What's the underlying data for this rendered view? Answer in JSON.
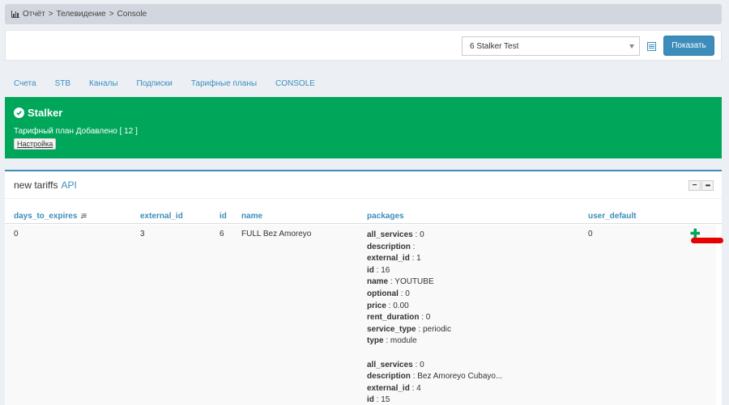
{
  "breadcrumb": {
    "items": [
      "Отчёт",
      "Телевидение",
      "Console"
    ],
    "separator": ">"
  },
  "toolbar": {
    "select_value": "6 Stalker Test",
    "show_label": "Показать"
  },
  "tabs": [
    "Счета",
    "STB",
    "Каналы",
    "Подписки",
    "Тарифные планы",
    "CONSOLE"
  ],
  "alert": {
    "title": "Stalker",
    "message": "Тарифный план Добавлено [ 12 ]",
    "button_label": "Настройка"
  },
  "panel": {
    "title": "new tariffs",
    "title_link": "API"
  },
  "table": {
    "headers": [
      "days_to_expires",
      "external_id",
      "id",
      "name",
      "packages",
      "user_default"
    ],
    "row": {
      "days_to_expires": "0",
      "external_id": "3",
      "id": "6",
      "name": "FULL Bez Amoreyo",
      "user_default": "0",
      "packages": [
        [
          {
            "k": "all_services",
            "v": "0"
          },
          {
            "k": "description",
            "v": ""
          },
          {
            "k": "external_id",
            "v": "1"
          },
          {
            "k": "id",
            "v": "16"
          },
          {
            "k": "name",
            "v": "YOUTUBE"
          },
          {
            "k": "optional",
            "v": "0"
          },
          {
            "k": "price",
            "v": "0.00"
          },
          {
            "k": "rent_duration",
            "v": "0"
          },
          {
            "k": "service_type",
            "v": "periodic"
          },
          {
            "k": "type",
            "v": "module"
          }
        ],
        [
          {
            "k": "all_services",
            "v": "0"
          },
          {
            "k": "description",
            "v": "Bez Amoreyo Cubayo..."
          },
          {
            "k": "external_id",
            "v": "4"
          },
          {
            "k": "id",
            "v": "15"
          }
        ]
      ]
    }
  },
  "colors": {
    "accent": "#3c8dbc",
    "success": "#00a65a",
    "highlight": "#e60000"
  }
}
